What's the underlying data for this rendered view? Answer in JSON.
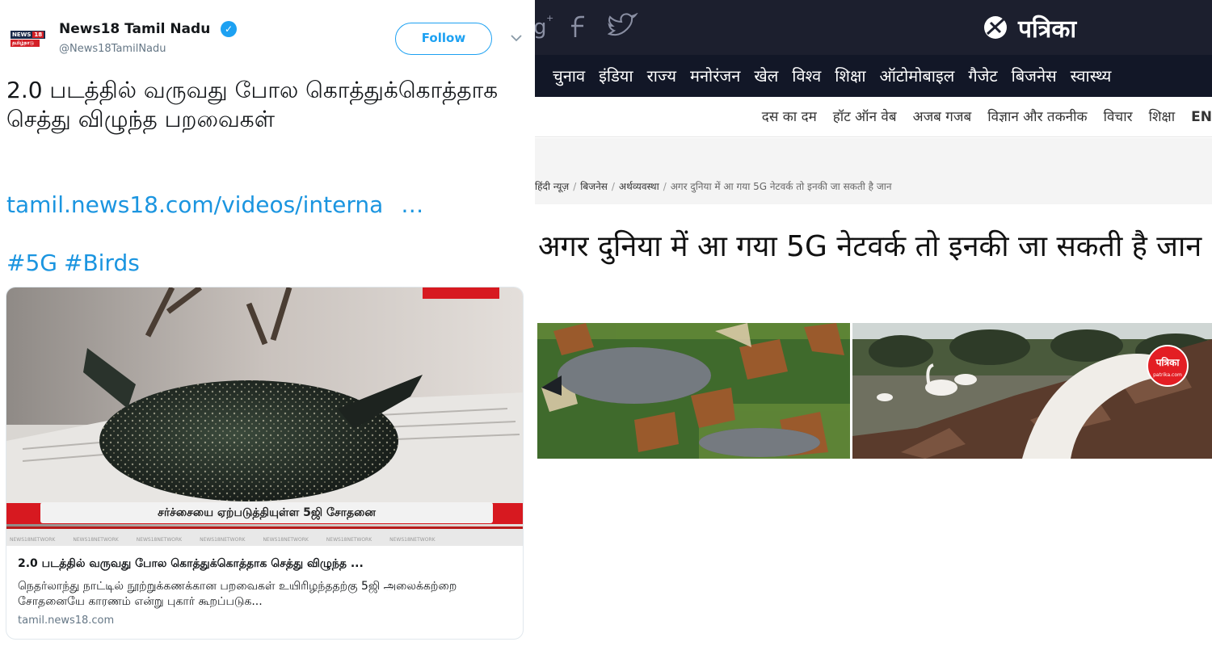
{
  "tweet": {
    "author_name": "News18 Tamil Nadu",
    "handle": "@News18TamilNadu",
    "follow_label": "Follow",
    "avatar_text_top": "NEWS",
    "avatar_text_num": "18",
    "avatar_text_bottom": "தமிழ்நாடு",
    "text": "2.0 படத்தில் வருவது போல கொத்துக்கொத்தாக செத்து விழுந்த பறவைகள்",
    "link": "tamil.news18.com/videos/interna",
    "link_ellipsis": "…",
    "hashtags": [
      "#5G",
      "#Birds"
    ],
    "card": {
      "image_caption": "சர்ச்சையை ஏற்படுத்தியுள்ள 5ஜி சோதனை",
      "ticker_text": "NEWS18NETWORK",
      "title": "2.0 படத்தில் வருவது போல கொத்துக்கொத்தாக செத்து விழுந்த ...",
      "description": "நெதர்லாந்து நாட்டில் நூற்றுக்கணக்கான பறவைகள் உயிரிழந்ததற்கு 5ஜி அலைக்கற்றை சோதனையே காரணம் என்று புகார் கூறப்படுக...",
      "domain": "tamil.news18.com"
    }
  },
  "patrika": {
    "logo_text": "पत्रिका",
    "nav": [
      "चुनाव",
      "इंडिया",
      "राज्य",
      "मनोरंजन",
      "खेल",
      "विश्व",
      "शिक्षा",
      "ऑटोमोबाइल",
      "गैजेट",
      "बिजनेस",
      "स्वास्थ्य"
    ],
    "subnav": [
      "दस का दम",
      "हॉट ऑन वेब",
      "अजब गजब",
      "विज्ञान और तकनीक",
      "विचार",
      "शिक्षा",
      "EN"
    ],
    "breadcrumb": [
      "हिंदी न्यूज़",
      "बिजनेस",
      "अर्थव्यवस्था"
    ],
    "breadcrumb_current": "अगर दुनिया में आ गया 5G नेटवर्क तो इनकी जा सकती है जान",
    "headline": "अगर दुनिया में आ गया 5G नेटवर्क तो इनकी जा सकती है जान",
    "image_badge": "पत्रिका",
    "image_badge_sub": "patrika.com"
  },
  "colors": {
    "twitter_blue": "#1da1f2",
    "link_blue": "#1b95e0",
    "patrika_header": "#1c1f2e",
    "patrika_nav": "#121727",
    "news18_red": "#d71920"
  }
}
